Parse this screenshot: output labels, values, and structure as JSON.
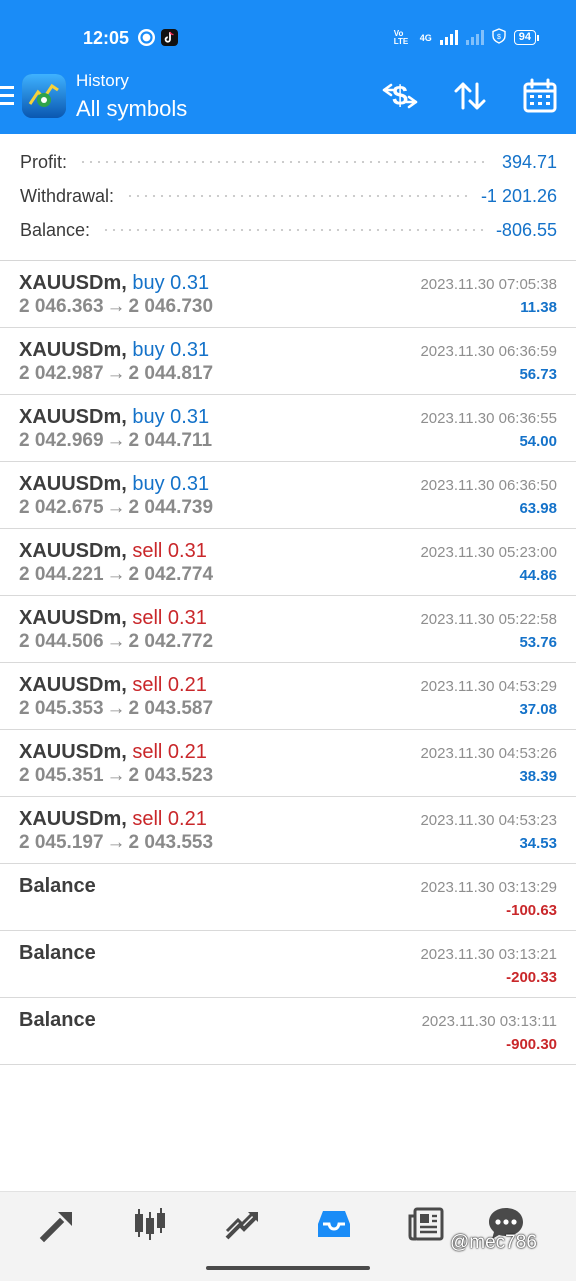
{
  "status_bar": {
    "time": "12:05",
    "network": "4G",
    "volte": "Vo LTE",
    "battery": "94"
  },
  "header": {
    "menu_icon": "hamburger-menu-icon",
    "subtitle": "History",
    "title": "All symbols",
    "actions": [
      "dollar-transfer-icon",
      "sort-icon",
      "calendar-icon"
    ]
  },
  "summary": {
    "profit_label": "Profit:",
    "profit_value": "394.71",
    "withdrawal_label": "Withdrawal:",
    "withdrawal_value": "-1 201.26",
    "balance_label": "Balance:",
    "balance_value": "-806.55"
  },
  "deals": [
    {
      "symbol": "XAUUSDm,",
      "type": "buy 0.31",
      "side": "buy",
      "open": "2 046.363",
      "close": "2 046.730",
      "time": "2023.11.30 07:05:38",
      "profit": "11.38"
    },
    {
      "symbol": "XAUUSDm,",
      "type": "buy 0.31",
      "side": "buy",
      "open": "2 042.987",
      "close": "2 044.817",
      "time": "2023.11.30 06:36:59",
      "profit": "56.73"
    },
    {
      "symbol": "XAUUSDm,",
      "type": "buy 0.31",
      "side": "buy",
      "open": "2 042.969",
      "close": "2 044.711",
      "time": "2023.11.30 06:36:55",
      "profit": "54.00"
    },
    {
      "symbol": "XAUUSDm,",
      "type": "buy 0.31",
      "side": "buy",
      "open": "2 042.675",
      "close": "2 044.739",
      "time": "2023.11.30 06:36:50",
      "profit": "63.98"
    },
    {
      "symbol": "XAUUSDm,",
      "type": "sell 0.31",
      "side": "sell",
      "open": "2 044.221",
      "close": "2 042.774",
      "time": "2023.11.30 05:23:00",
      "profit": "44.86"
    },
    {
      "symbol": "XAUUSDm,",
      "type": "sell 0.31",
      "side": "sell",
      "open": "2 044.506",
      "close": "2 042.772",
      "time": "2023.11.30 05:22:58",
      "profit": "53.76"
    },
    {
      "symbol": "XAUUSDm,",
      "type": "sell 0.21",
      "side": "sell",
      "open": "2 045.353",
      "close": "2 043.587",
      "time": "2023.11.30 04:53:29",
      "profit": "37.08"
    },
    {
      "symbol": "XAUUSDm,",
      "type": "sell 0.21",
      "side": "sell",
      "open": "2 045.351",
      "close": "2 043.523",
      "time": "2023.11.30 04:53:26",
      "profit": "38.39"
    },
    {
      "symbol": "XAUUSDm,",
      "type": "sell 0.21",
      "side": "sell",
      "open": "2 045.197",
      "close": "2 043.553",
      "time": "2023.11.30 04:53:23",
      "profit": "34.53"
    }
  ],
  "balance_ops": [
    {
      "label": "Balance",
      "time": "2023.11.30 03:13:29",
      "amount": "-100.63"
    },
    {
      "label": "Balance",
      "time": "2023.11.30 03:13:21",
      "amount": "-200.33"
    },
    {
      "label": "Balance",
      "time": "2023.11.30 03:13:11",
      "amount": "-900.30"
    }
  ],
  "deal_arrow": "→",
  "bottom_nav": {
    "items": [
      "quotes-icon",
      "chart-icon",
      "trade-icon",
      "history-icon",
      "news-icon",
      "chat-icon"
    ],
    "active": "history-icon"
  },
  "watermark": "@mec786",
  "colors": {
    "accent": "#1a8cf7",
    "buy": "#1472c9",
    "sell": "#c9272a",
    "positive": "#1472c9",
    "negative": "#c9272a"
  }
}
